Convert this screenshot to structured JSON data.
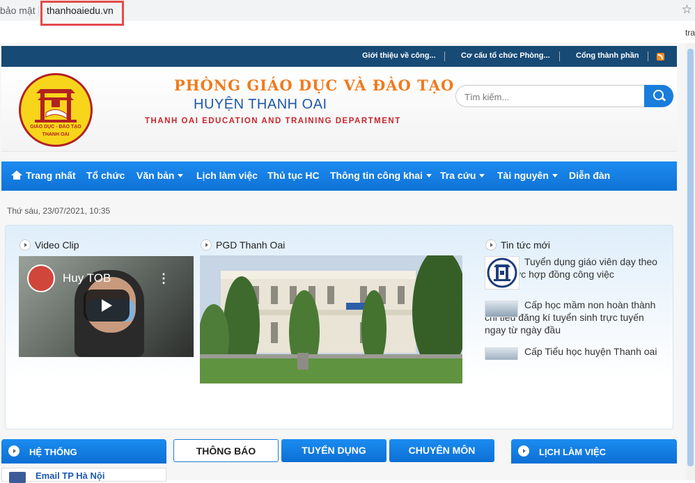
{
  "browser": {
    "security_text": "bảo mật",
    "url": "thanhoaiedu.vn",
    "ext_fragment": "tra"
  },
  "topbar": {
    "links": [
      "Giới thiệu về công...",
      "Cơ cấu tổ chức Phòng...",
      "Cổng thành phần"
    ]
  },
  "header": {
    "title_line1": "PHÒNG GIÁO DỤC VÀ ĐÀO TẠO",
    "title_line2": "HUYỆN THANH OAI",
    "title_line3": "THANH OAI EDUCATION AND TRAINING DEPARTMENT",
    "logo_text1": "GIÁO DỤC - ĐÀO TẠO",
    "logo_text2": "THANH OAI",
    "search_placeholder": "Tìm kiếm..."
  },
  "nav": {
    "items": [
      {
        "label": "Trang nhất",
        "dropdown": false
      },
      {
        "label": "Tổ chức",
        "dropdown": false
      },
      {
        "label": "Văn bản",
        "dropdown": true
      },
      {
        "label": "Lịch làm việc",
        "dropdown": false
      },
      {
        "label": "Thủ tục HC",
        "dropdown": false
      },
      {
        "label": "Thông tin công khai",
        "dropdown": true
      },
      {
        "label": "Tra cứu",
        "dropdown": true
      },
      {
        "label": "Tài nguyên",
        "dropdown": true
      },
      {
        "label": "Diễn đàn",
        "dropdown": false
      }
    ]
  },
  "date": "Thứ sáu, 23/07/2021, 10:35",
  "featured": {
    "video_section_title": "Video Clip",
    "video_title": "Huy TOB",
    "photo_section_title": "PGD Thanh Oai",
    "news_section_title": "Tin tức mới",
    "news": [
      "Tuyển dụng giáo viên dạy theo hình thức hợp đồng công việc",
      "Cấp học mầm non hoàn thành chỉ tiêu đăng kí tuyển sinh trực tuyến ngay từ ngày đầu",
      "Cấp Tiểu học huyện Thanh oai"
    ]
  },
  "bottom": {
    "left_head": "HỆ THỐNG",
    "tabs": [
      "THÔNG BÁO",
      "TUYỂN DỤNG",
      "CHUYÊN MÔN"
    ],
    "right_head": "LỊCH LÀM VIỆC",
    "email_item": "Email TP Hà Nội"
  },
  "colors": {
    "topbar": "#174a75",
    "nav": "#1a7ddb",
    "title_orange": "#f07a1c",
    "title_blue": "#1d58a8",
    "title_red": "#c8262b"
  }
}
